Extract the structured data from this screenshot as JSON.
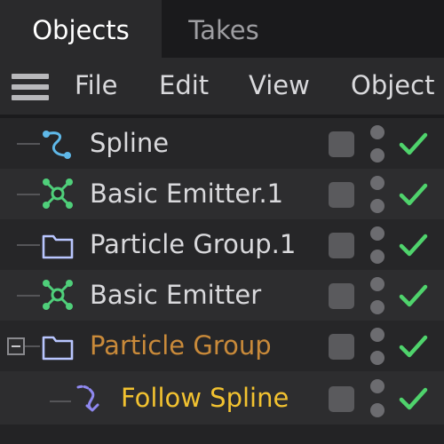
{
  "tabs": [
    {
      "label": "Objects",
      "active": true
    },
    {
      "label": "Takes",
      "active": false
    }
  ],
  "menu": {
    "icon": "hamburger-menu-icon",
    "items": [
      "File",
      "Edit",
      "View",
      "Object"
    ]
  },
  "objects": [
    {
      "label": "Spline",
      "icon": "spline-icon",
      "color": "#d9d9dc",
      "icon_color": "#5fb8e8"
    },
    {
      "label": "Basic Emitter.1",
      "icon": "emitter-icon",
      "color": "#d9d9dc",
      "icon_color": "#4fcf7a"
    },
    {
      "label": "Particle Group.1",
      "icon": "folder-icon",
      "color": "#d9d9dc",
      "icon_color": "#b9c6ff"
    },
    {
      "label": "Basic Emitter",
      "icon": "emitter-icon",
      "color": "#d9d9dc",
      "icon_color": "#4fcf7a"
    },
    {
      "label": "Particle Group",
      "icon": "folder-icon",
      "color": "#c98a3a",
      "icon_color": "#b9c6ff",
      "expanded": true
    },
    {
      "label": "Follow Spline",
      "icon": "follow-spline-icon",
      "color": "#f2c230",
      "icon_color": "#8f88f0",
      "child": true
    }
  ],
  "colors": {
    "check": "#4fd36c",
    "edit": "#5a5a5d",
    "dot": "#6c6c70"
  }
}
